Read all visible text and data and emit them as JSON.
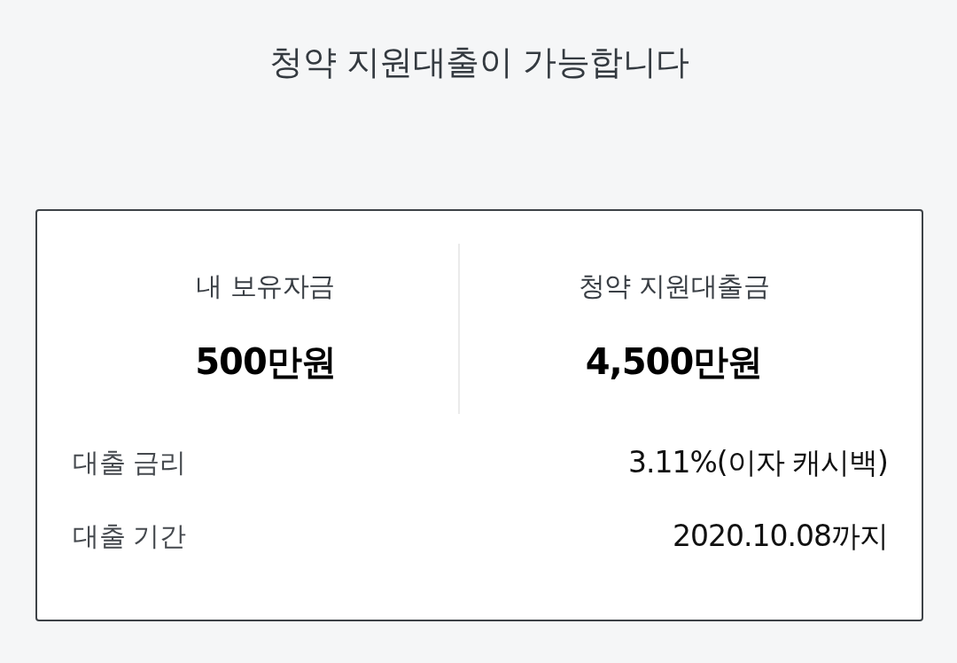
{
  "title": "청약 지원대출이 가능합니다",
  "summary": [
    {
      "label": "내 보유자금",
      "value": "500만원"
    },
    {
      "label": "청약 지원대출금",
      "value": "4,500만원"
    }
  ],
  "details": [
    {
      "label": "대출 금리",
      "value": "3.11%(이자 캐시백)"
    },
    {
      "label": "대출 기간",
      "value": "2020.10.08까지"
    }
  ]
}
